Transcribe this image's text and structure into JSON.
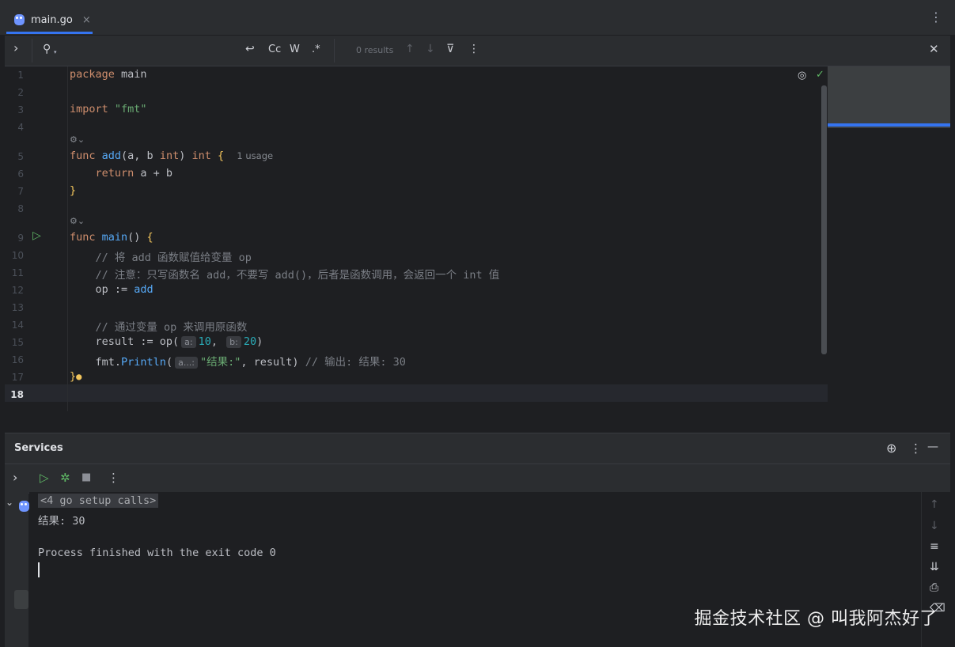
{
  "tab": {
    "filename": "main.go",
    "close": "×",
    "more": "⋮"
  },
  "search": {
    "expand": "›",
    "search_icon": "⚲",
    "wrap": "↩",
    "match_case": "Cc",
    "whole_words": "W",
    "regex": ".*",
    "results": "0 results",
    "up": "↑",
    "down": "↓",
    "filter": "⊽",
    "more": "⋮",
    "close": "✕"
  },
  "editor": {
    "lines": [
      "1",
      "2",
      "3",
      "4",
      "5",
      "6",
      "7",
      "8",
      "9",
      "10",
      "11",
      "12",
      "13",
      "14",
      "15",
      "16",
      "17",
      "18"
    ],
    "code": {
      "l1_kw": "package",
      "l1_rest": " main",
      "l3_kw": "import",
      "l3_str": " \"fmt\"",
      "l5_kw": "func",
      "l5_fn": " add",
      "l5_a": "(a, b ",
      "l5_t1": "int",
      "l5_b": ") ",
      "l5_t2": "int",
      "l5_br": " {",
      "l5_usage": "1 usage",
      "l6_kw": "    return",
      "l6_rest": " a + b",
      "l7_br": "}",
      "l9_kw": "func",
      "l9_fn": " main",
      "l9_a": "() ",
      "l9_br": "{",
      "l10": "    // 将 add 函数赋值给变量 op",
      "l11": "    // 注意：只写函数名 add，不要写 add()，后者是函数调用，会返回一个 int 值",
      "l12_a": "    op := ",
      "l12_fn": "add",
      "l14": "    // 通过变量 op 来调用原函数",
      "l15_a": "    result := op(",
      "l15_h1": "a:",
      "l15_n1": "10",
      "l15_b": ", ",
      "l15_h2": "b:",
      "l15_n2": "20",
      "l15_c": ")",
      "l16_a": "    fmt.",
      "l16_fn": "Println",
      "l16_b": "(",
      "l16_h": "a...:",
      "l16_str": "\"结果:\"",
      "l16_c": ", result) ",
      "l16_cm": "// 输出: 结果: 30",
      "l17_br": "}",
      "lens": "⚙⌄"
    }
  },
  "services": {
    "title": "Services",
    "crosshair": "⊕",
    "more": "⋮",
    "minimize": "—",
    "expand": "›",
    "run": "▷",
    "debug": "✲",
    "stop": "■",
    "tool_more": "⋮",
    "tree_expand": "⌄"
  },
  "console": {
    "setup": "<4 go setup calls>",
    "result": "结果: 30",
    "finished": "Process finished with the exit code 0"
  },
  "watermark": "掘金技术社区 @ 叫我阿杰好了"
}
